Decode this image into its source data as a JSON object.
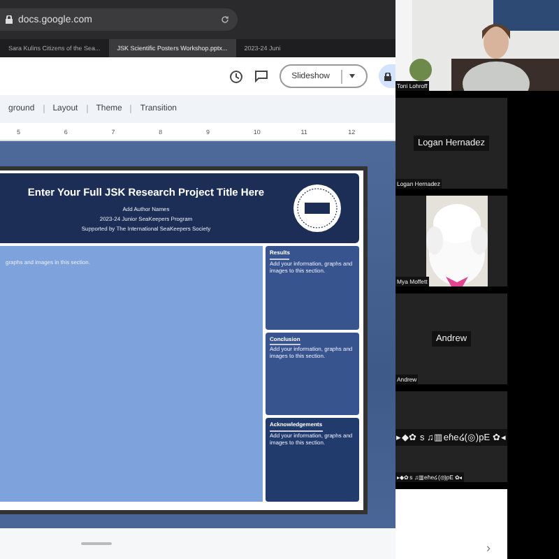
{
  "browser": {
    "address": "docs.google.com",
    "tabs": [
      {
        "label": "Sara Kulins Citizens of the Sea...",
        "selected": false
      },
      {
        "label": "JSK Scientific Posters Workshop.pptx...",
        "selected": true
      },
      {
        "label": "2023-24 Juni",
        "selected": false
      }
    ]
  },
  "toolbar": {
    "slideshow": "Slideshow"
  },
  "menu": [
    "ground",
    "Layout",
    "Theme",
    "Transition"
  ],
  "ruler": [
    "5",
    "6",
    "7",
    "8",
    "9",
    "10",
    "11",
    "12"
  ],
  "slide": {
    "title": "Enter Your Full JSK Research Project Title Here",
    "subtitle_lines": [
      "Add Author Names",
      "2023-24 Junior SeaKeepers Program",
      "Supported by The International SeaKeepers Society"
    ],
    "main_text": "graphs and images in this section.",
    "sections": [
      {
        "heading": "Results",
        "text": "Add your information, graphs and images to this section."
      },
      {
        "heading": "Conclusion",
        "text": "Add your information, graphs and images to this section."
      },
      {
        "heading": "Acknowledgements",
        "text": "Add your information, graphs and images to this section."
      }
    ]
  },
  "participants": [
    {
      "kind": "video",
      "name": "Toni Lohroff"
    },
    {
      "kind": "name",
      "center_name": "Logan Hernadez",
      "name": "Logan Hernadez"
    },
    {
      "kind": "pet",
      "name": "Mya Moffett"
    },
    {
      "kind": "name",
      "center_name": "Andrew",
      "name": "Andrew"
    },
    {
      "kind": "name",
      "center_name": "▸◆✿ s ♫▥eɦe໒(◎)pE ✿◂",
      "name": "▸◆✿ s ♫▥eɦe໒(◎)pE ✿◂"
    }
  ],
  "next_chevron": "›"
}
